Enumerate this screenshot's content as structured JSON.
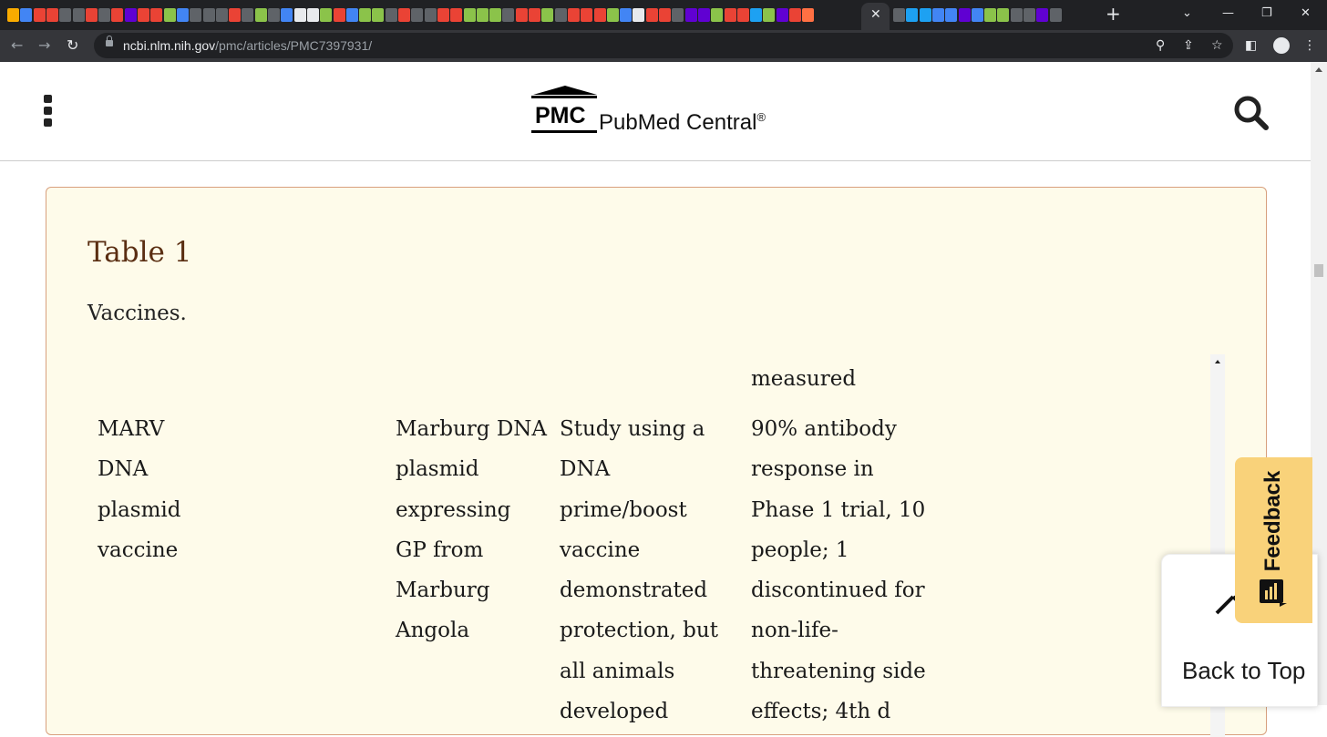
{
  "browser": {
    "url_host": "ncbi.nlm.nih.gov",
    "url_path": "/pmc/articles/PMC7397931/",
    "tab_colors": [
      "#f9ab00",
      "#4285f4",
      "#ea4335",
      "#ea4335",
      "#5f6368",
      "#5f6368",
      "#ea4335",
      "#5f6368",
      "#ea4335",
      "#6001d2",
      "#ea4335",
      "#ea4335",
      "#8bc34a",
      "#4285f4",
      "#5f6368",
      "#5f6368",
      "#5f6368",
      "#ea4335",
      "#5f6368",
      "#8bc34a",
      "#5f6368",
      "#4285f4",
      "#e8eaed",
      "#e8eaed",
      "#8bc34a",
      "#ea4335",
      "#4285f4",
      "#8bc34a",
      "#8bc34a",
      "#5f6368",
      "#ea4335",
      "#5f6368",
      "#5f6368",
      "#ea4335",
      "#ea4335",
      "#8bc34a",
      "#8bc34a",
      "#8bc34a",
      "#5f6368",
      "#ea4335",
      "#ea4335",
      "#8bc34a",
      "#5f6368",
      "#ea4335",
      "#ea4335",
      "#ea4335",
      "#8bc34a",
      "#4285f4",
      "#e8eaed",
      "#ea4335",
      "#ea4335",
      "#5f6368",
      "#6001d2",
      "#6001d2",
      "#8bc34a",
      "#ea4335",
      "#ea4335",
      "#1da1f2",
      "#8bc34a",
      "#6001d2",
      "#ea4335",
      "#ff7043"
    ],
    "tab_colors_right": [
      "#5f6368",
      "#1da1f2",
      "#1da1f2",
      "#4285f4",
      "#4285f4",
      "#6001d2",
      "#4285f4",
      "#8bc34a",
      "#8bc34a",
      "#5f6368",
      "#5f6368",
      "#6001d2",
      "#5f6368"
    ]
  },
  "header": {
    "logo_abbr": "PMC",
    "logo_name": "PubMed Central",
    "logo_mark": "®"
  },
  "table": {
    "title": "Table 1",
    "caption": "Vaccines.",
    "partial_header": "measured",
    "row": {
      "name": [
        "MARV",
        "DNA",
        "plasmid",
        "vaccine"
      ],
      "description": [
        "Marburg DNA",
        "plasmid",
        "expressing",
        "GP from",
        "Marburg",
        "Angola"
      ],
      "findings": [
        "Study using a",
        "DNA",
        "prime/boost",
        "vaccine",
        "demonstrated",
        "protection, but",
        "all animals",
        "developed"
      ],
      "results": [
        "90% antibody",
        "response in",
        "Phase 1 trial, 10",
        "people; 1",
        "discontinued for",
        "non-life-",
        "threatening side",
        "effects; 4th d"
      ]
    }
  },
  "widgets": {
    "back_to_top": "Back to Top",
    "feedback": "Feedback"
  }
}
